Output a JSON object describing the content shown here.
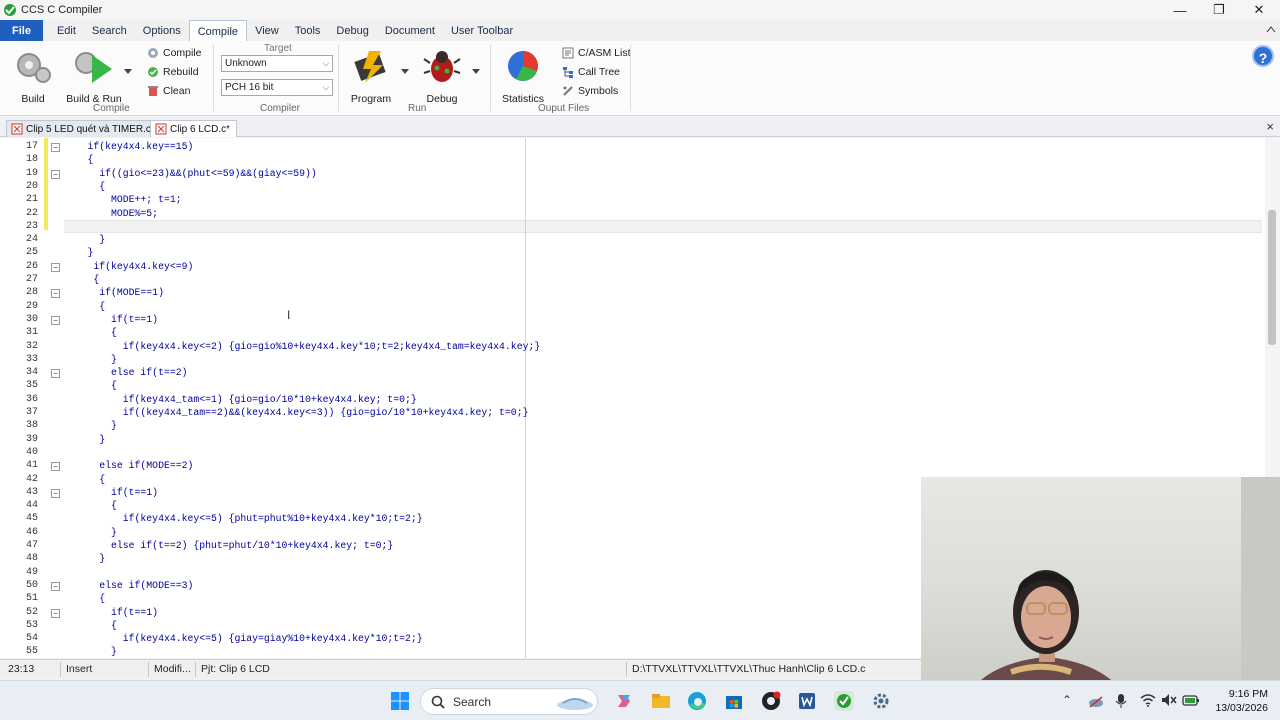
{
  "window": {
    "title": "CCS C Compiler",
    "minimize": "—",
    "restore": "❐",
    "close": "✕"
  },
  "menu": [
    "File",
    "Edit",
    "Search",
    "Options",
    "Compile",
    "View",
    "Tools",
    "Debug",
    "Document",
    "User Toolbar"
  ],
  "menu_active": "Compile",
  "ribbon": {
    "build": "Build",
    "build_run": "Build & Run",
    "compile": "Compile",
    "rebuild": "Rebuild",
    "clean": "Clean",
    "group_compile": "Compile",
    "target_label": "Target",
    "target_value": "Unknown",
    "pch_value": "PCH 16 bit",
    "group_compiler": "Compiler",
    "program": "Program",
    "debug": "Debug",
    "group_run": "Run",
    "statistics": "Statistics",
    "casm_list": "C/ASM List",
    "call_tree": "Call Tree",
    "symbols": "Symbols",
    "group_output": "Ouput Files",
    "help_glyph": "?"
  },
  "tabs": [
    {
      "label": "Clip 5 LED quét và TIMER.c",
      "active": false
    },
    {
      "label": "Clip 6 LCD.c*",
      "active": true
    }
  ],
  "tabs_close": "×",
  "editor": {
    "lines": [
      {
        "n": "17",
        "code": "    if(key4x4.key==15)"
      },
      {
        "n": "18",
        "code": "    {"
      },
      {
        "n": "19",
        "code": "      if((gio<=23)&&(phut<=59)&&(giay<=59))"
      },
      {
        "n": "20",
        "code": "      {"
      },
      {
        "n": "21",
        "code": "        MODE++; t=1;"
      },
      {
        "n": "22",
        "code": "        MODE%=5;"
      },
      {
        "n": "23",
        "code": ""
      },
      {
        "n": "24",
        "code": "      }"
      },
      {
        "n": "25",
        "code": "    }"
      },
      {
        "n": "26",
        "code": "     if(key4x4.key<=9)"
      },
      {
        "n": "27",
        "code": "     {"
      },
      {
        "n": "28",
        "code": "      if(MODE==1)"
      },
      {
        "n": "29",
        "code": "      {"
      },
      {
        "n": "30",
        "code": "        if(t==1)"
      },
      {
        "n": "31",
        "code": "        {"
      },
      {
        "n": "32",
        "code": "          if(key4x4.key<=2) {gio=gio%10+key4x4.key*10;t=2;key4x4_tam=key4x4.key;}"
      },
      {
        "n": "33",
        "code": "        }"
      },
      {
        "n": "34",
        "code": "        else if(t==2)"
      },
      {
        "n": "35",
        "code": "        {"
      },
      {
        "n": "36",
        "code": "          if(key4x4_tam<=1) {gio=gio/10*10+key4x4.key; t=0;}"
      },
      {
        "n": "37",
        "code": "          if((key4x4_tam==2)&&(key4x4.key<=3)) {gio=gio/10*10+key4x4.key; t=0;}"
      },
      {
        "n": "38",
        "code": "        }"
      },
      {
        "n": "39",
        "code": "      }"
      },
      {
        "n": "40",
        "code": ""
      },
      {
        "n": "41",
        "code": "      else if(MODE==2)"
      },
      {
        "n": "42",
        "code": "      {"
      },
      {
        "n": "43",
        "code": "        if(t==1)"
      },
      {
        "n": "44",
        "code": "        {"
      },
      {
        "n": "45",
        "code": "          if(key4x4.key<=5) {phut=phut%10+key4x4.key*10;t=2;}"
      },
      {
        "n": "46",
        "code": "        }"
      },
      {
        "n": "47",
        "code": "        else if(t==2) {phut=phut/10*10+key4x4.key; t=0;}"
      },
      {
        "n": "48",
        "code": "      }"
      },
      {
        "n": "49",
        "code": ""
      },
      {
        "n": "50",
        "code": "      else if(MODE==3)"
      },
      {
        "n": "51",
        "code": "      {"
      },
      {
        "n": "52",
        "code": "        if(t==1)"
      },
      {
        "n": "53",
        "code": "        {"
      },
      {
        "n": "54",
        "code": "          if(key4x4.key<=5) {giay=giay%10+key4x4.key*10;t=2;}"
      },
      {
        "n": "55",
        "code": "        }"
      }
    ],
    "fold_lines": [
      "17",
      "19",
      "26",
      "28",
      "30",
      "34",
      "41",
      "43",
      "50",
      "52"
    ]
  },
  "status": {
    "position": "23:13",
    "mode": "Insert",
    "modified": "Modifi...",
    "project": "Pjt: Clip 6 LCD",
    "path": "D:\\TTVXL\\TTVXL\\TTVXL\\Thuc Hanh\\Clip 6 LCD.c"
  },
  "taskbar": {
    "search": "Search",
    "time": "9:16 PM",
    "date": "13/03/2026",
    "tray_chevron": "⌃"
  }
}
